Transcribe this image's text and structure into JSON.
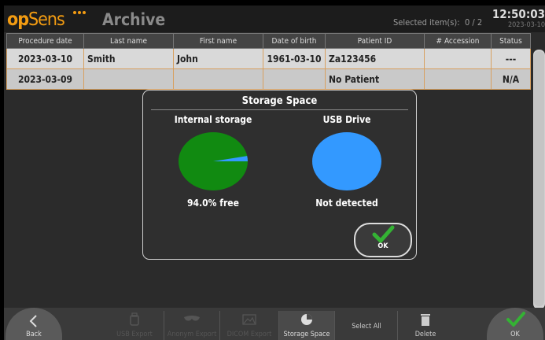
{
  "header": {
    "logo_op": "op",
    "logo_sens": "Sens",
    "title": "Archive",
    "selected_label": "Selected item(s):",
    "selected_value": "0 / 2",
    "time": "12:50:03",
    "date": "2023-03-10"
  },
  "table": {
    "columns": [
      "Procedure date",
      "Last name",
      "First name",
      "Date of birth",
      "Patient ID",
      "# Accession",
      "Status"
    ],
    "rows": [
      [
        "2023-03-10",
        "Smith",
        "John",
        "1961-03-10",
        "Za123456",
        "",
        "---"
      ],
      [
        "2023-03-09",
        "",
        "",
        "",
        "No Patient",
        "",
        "N/A"
      ]
    ]
  },
  "dialog": {
    "title": "Storage Space",
    "internal": {
      "label": "Internal storage",
      "free_fraction": 0.94,
      "free_text": "94.0% free"
    },
    "usb": {
      "label": "USB Drive",
      "status": "Not detected"
    },
    "ok_label": "OK"
  },
  "toolbar": {
    "back": "Back",
    "usb_export": "USB Export",
    "anonym_export": "Anonym Export",
    "dicom_export": "DICOM Export",
    "storage_space": "Storage Space",
    "select_all": "Select All",
    "delete": "Delete",
    "ok": "OK"
  },
  "colors": {
    "accent": "#f39c12",
    "row_border": "#d8a060",
    "free": "#118a11",
    "used": "#3399ff",
    "check": "#34b234"
  }
}
